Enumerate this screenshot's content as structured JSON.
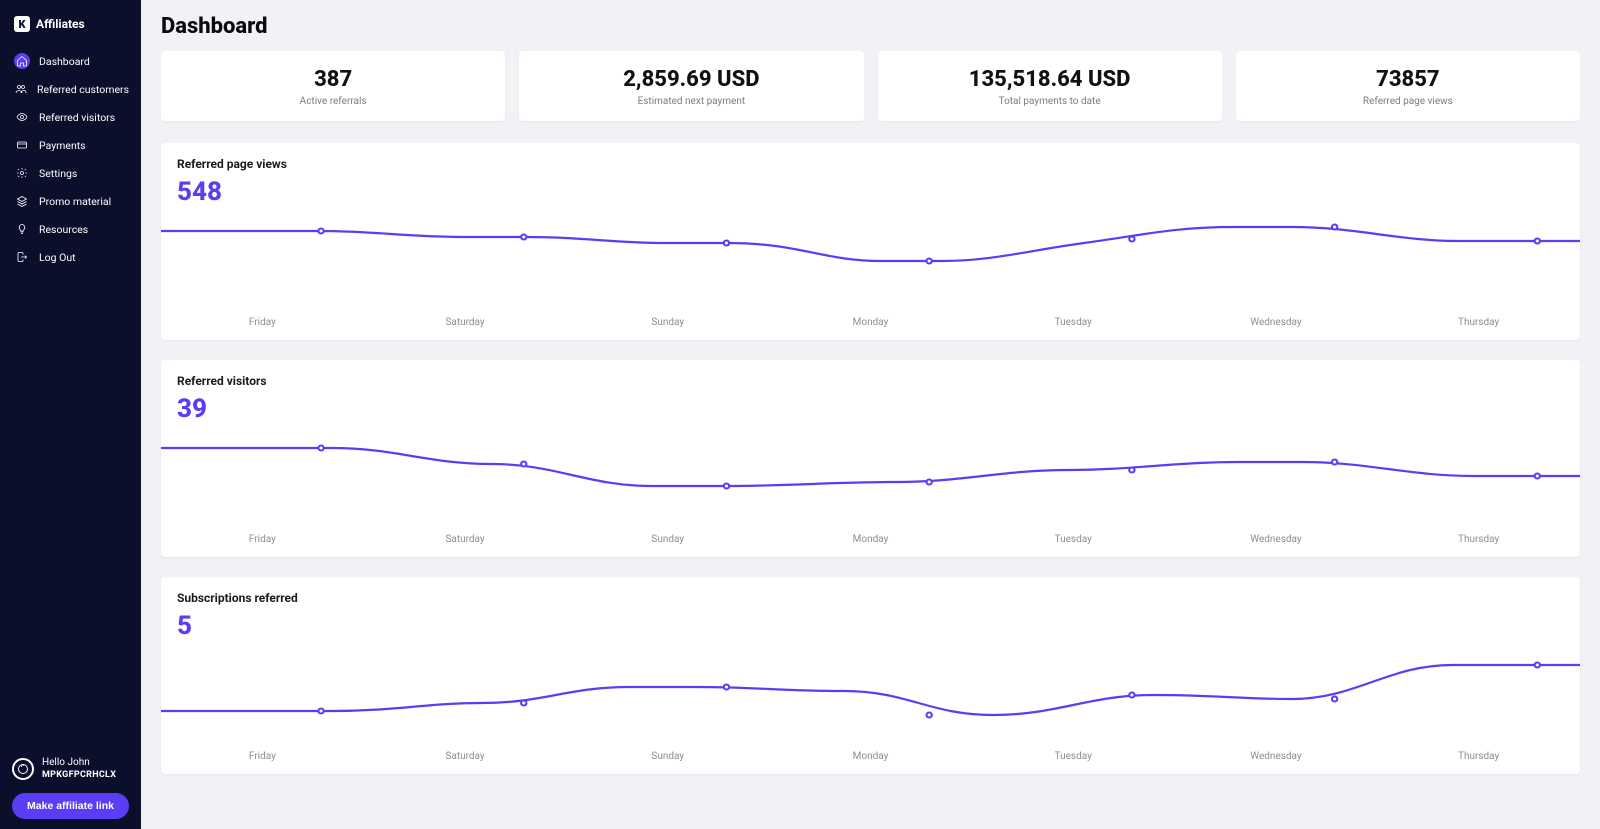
{
  "brand": "Affiliates",
  "sidebar": {
    "items": [
      {
        "label": "Dashboard",
        "icon": "home",
        "active": true
      },
      {
        "label": "Referred customers",
        "icon": "users",
        "active": false
      },
      {
        "label": "Referred visitors",
        "icon": "eye",
        "active": false
      },
      {
        "label": "Payments",
        "icon": "card",
        "active": false
      },
      {
        "label": "Settings",
        "icon": "gear",
        "active": false
      },
      {
        "label": "Promo material",
        "icon": "layers",
        "active": false
      },
      {
        "label": "Resources",
        "icon": "bulb",
        "active": false
      },
      {
        "label": "Log Out",
        "icon": "logout",
        "active": false
      }
    ],
    "user": {
      "greeting": "Hello John",
      "code": "MPKGFPCRHCLX"
    },
    "cta": "Make affiliate link"
  },
  "page": {
    "title": "Dashboard"
  },
  "stats": [
    {
      "value": "387",
      "label": "Active referrals"
    },
    {
      "value": "2,859.69 USD",
      "label": "Estimated next payment"
    },
    {
      "value": "135,518.64 USD",
      "label": "Total payments to date"
    },
    {
      "value": "73857",
      "label": "Referred page views"
    }
  ],
  "charts": [
    {
      "title": "Referred page views",
      "big": "548",
      "categories": [
        "Friday",
        "Saturday",
        "Sunday",
        "Monday",
        "Tuesday",
        "Wednesday",
        "Thursday"
      ]
    },
    {
      "title": "Referred visitors",
      "big": "39",
      "categories": [
        "Friday",
        "Saturday",
        "Sunday",
        "Monday",
        "Tuesday",
        "Wednesday",
        "Thursday"
      ]
    },
    {
      "title": "Subscriptions referred",
      "big": "5",
      "categories": [
        "Friday",
        "Saturday",
        "Sunday",
        "Monday",
        "Tuesday",
        "Wednesday",
        "Thursday"
      ]
    }
  ],
  "chart_data": [
    {
      "type": "line",
      "title": "Referred page views",
      "xlabel": "",
      "ylabel": "",
      "categories": [
        "Friday",
        "Saturday",
        "Sunday",
        "Monday",
        "Tuesday",
        "Wednesday",
        "Thursday"
      ],
      "values": [
        78,
        72,
        66,
        48,
        70,
        82,
        68
      ],
      "ylim": [
        0,
        100
      ]
    },
    {
      "type": "line",
      "title": "Referred visitors",
      "xlabel": "",
      "ylabel": "",
      "categories": [
        "Friday",
        "Saturday",
        "Sunday",
        "Monday",
        "Tuesday",
        "Wednesday",
        "Thursday"
      ],
      "values": [
        78,
        62,
        40,
        44,
        56,
        64,
        50
      ],
      "ylim": [
        0,
        100
      ]
    },
    {
      "type": "line",
      "title": "Subscriptions referred",
      "xlabel": "",
      "ylabel": "",
      "categories": [
        "Friday",
        "Saturday",
        "Sunday",
        "Monday",
        "Tuesday",
        "Wednesday",
        "Thursday"
      ],
      "values": [
        32,
        40,
        56,
        52,
        28,
        48,
        44,
        78
      ],
      "ylim": [
        0,
        100
      ]
    }
  ],
  "colors": {
    "accent": "#5b3df5"
  }
}
